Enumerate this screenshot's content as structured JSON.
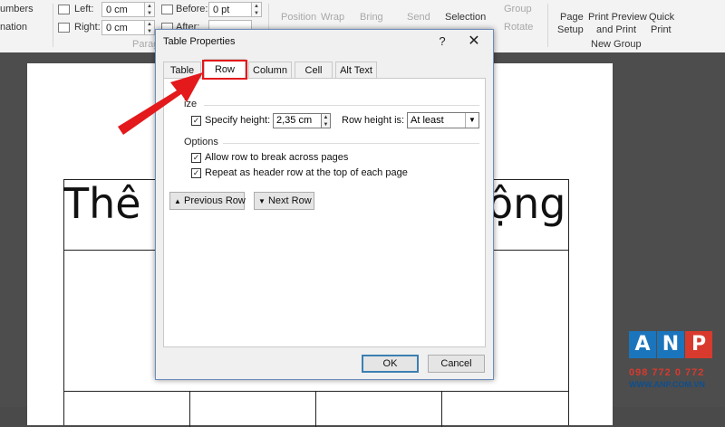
{
  "ribbon": {
    "numbering_label": "umbers",
    "lines_label": "nation",
    "indent_left_label": "Left:",
    "indent_left_value": "0 cm",
    "indent_right_label": "Right:",
    "indent_right_value": "0 cm",
    "before_label": "Before:",
    "before_value": "0 pt",
    "after_label": "After:",
    "group_paragraph_label": "Parag",
    "position_label": "Position",
    "wrap_label": "Wrap",
    "bring_label": "Bring",
    "send_label": "Send",
    "selection_label": "Selection",
    "group_label": "Group",
    "rotate_label": "Rotate",
    "page_setup_label_1": "Page",
    "page_setup_label_2": "Setup",
    "print_preview_label_1": "Print Preview",
    "print_preview_label_2": "and Print",
    "quick_print_label_1": "Quick",
    "quick_print_label_2": "Print",
    "new_group_label": "New Group"
  },
  "document": {
    "heading_left": "Thê",
    "heading_right": "ộng"
  },
  "dialog": {
    "title": "Table Properties",
    "help_label": "?",
    "close_label": "✕",
    "tabs": [
      {
        "label": "Table",
        "accel": "T"
      },
      {
        "label": "Row",
        "accel": "R"
      },
      {
        "label": "Column",
        "accel": "U"
      },
      {
        "label": "Cell",
        "accel": "E"
      },
      {
        "label": "Alt Text",
        "accel": "A"
      }
    ],
    "active_tab": "Row",
    "size_section_label": "ize",
    "specify_height_label": "Specify height:",
    "specify_height_checked": true,
    "height_value": "2,35 cm",
    "row_height_is_label": "Row height is:",
    "row_height_is_value": "At least",
    "options_section_label": "Options",
    "allow_break_label": "Allow row to break across pages",
    "allow_break_checked": true,
    "repeat_header_label": "Repeat as header row at the top of each page",
    "repeat_header_checked": true,
    "previous_row_label": "Previous Row",
    "next_row_label": "Next Row",
    "ok_label": "OK",
    "cancel_label": "Cancel"
  },
  "logo": {
    "letters": [
      "A",
      "N",
      "P"
    ],
    "phone": "098 772 0 772",
    "website": "WWW.ANP.COM.VN"
  },
  "colors": {
    "highlight_red": "#e3191c",
    "logo_blue": "#1b75bc",
    "logo_red": "#d83a2d"
  }
}
